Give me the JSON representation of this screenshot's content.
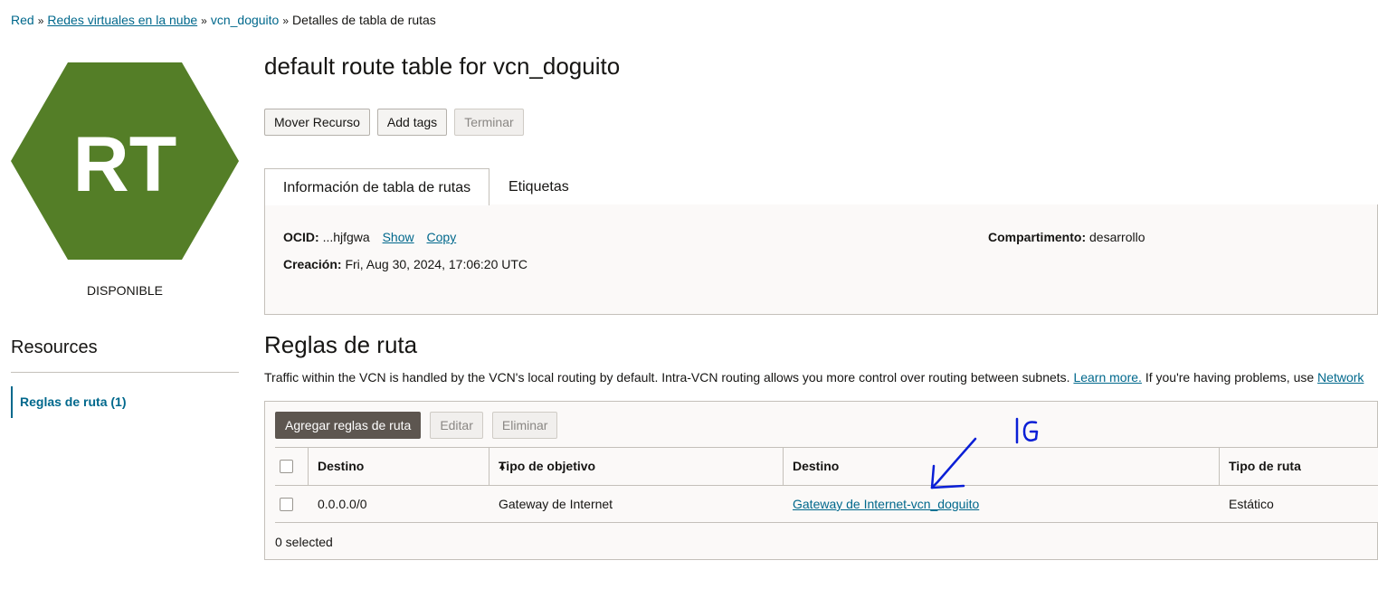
{
  "breadcrumb": {
    "items": [
      "Red",
      "Redes virtuales en la nube",
      "vcn_doguito"
    ],
    "current": "Detalles de tabla de rutas",
    "separator": "»"
  },
  "resource_icon": {
    "text": "RT",
    "color": "#547e27"
  },
  "status": "DISPONIBLE",
  "sidebar": {
    "title": "Resources",
    "items": [
      {
        "label": "Reglas de ruta (1)",
        "active": true
      }
    ]
  },
  "page": {
    "title": "default route table for vcn_doguito",
    "actions": {
      "move": "Mover Recurso",
      "add_tags": "Add tags",
      "terminate": "Terminar"
    }
  },
  "tabs": [
    {
      "label": "Información de tabla de rutas",
      "active": true
    },
    {
      "label": "Etiquetas",
      "active": false
    }
  ],
  "info": {
    "ocid_label": "OCID:",
    "ocid_value": "...hjfgwa",
    "show": "Show",
    "copy": "Copy",
    "created_label": "Creación:",
    "created_value": "Fri, Aug 30, 2024, 17:06:20 UTC",
    "compartment_label": "Compartimento:",
    "compartment_value": "desarrollo"
  },
  "rules": {
    "title": "Reglas de ruta",
    "description": "Traffic within the VCN is handled by the VCN's local routing by default. Intra-VCN routing allows you more control over routing between subnets.",
    "learn_more": "Learn more.",
    "problems_text": "If you're having problems, use",
    "network_link": "Network",
    "buttons": {
      "add": "Agregar reglas de ruta",
      "edit": "Editar",
      "delete": "Eliminar"
    },
    "columns": [
      "Destino",
      "Tipo de objetivo",
      "Destino",
      "Tipo de ruta"
    ],
    "rows": [
      {
        "destination": "0.0.0.0/0",
        "target_type": "Gateway de Internet",
        "target": "Gateway de Internet-vcn_doguito",
        "route_type": "Estático"
      }
    ],
    "selected_text": "0 selected"
  },
  "annotation": {
    "text": "IG",
    "color": "#0a1fd6"
  }
}
